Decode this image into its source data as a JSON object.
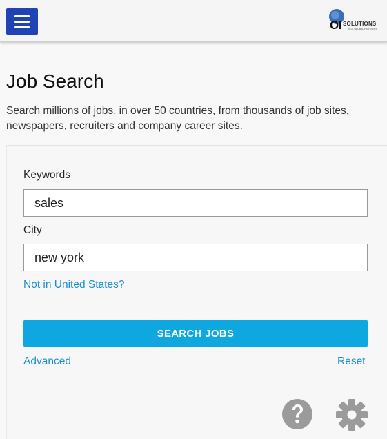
{
  "header": {
    "menu_icon": "hamburger-menu-icon",
    "logo": {
      "mark": "O",
      "text": "SOLUTIONS",
      "sub": "by OI GLOBAL PARTNERS"
    }
  },
  "page": {
    "title": "Job Search",
    "description": "Search millions of jobs, in over 50 countries, from thousands of job sites, newspapers, recruiters and company career sites."
  },
  "form": {
    "keywords_label": "Keywords",
    "keywords_value": "sales",
    "city_label": "City",
    "city_value": "new york",
    "country_link": "Not in United States?",
    "search_button": "SEARCH JOBS",
    "advanced_link": "Advanced",
    "reset_link": "Reset"
  },
  "footer_icons": [
    "help-icon",
    "gear-icon"
  ],
  "colors": {
    "menu_button": "#1f43b5",
    "accent": "#0ea7df",
    "link": "#1a8fd0",
    "icon_gray": "#9b9b9b"
  }
}
